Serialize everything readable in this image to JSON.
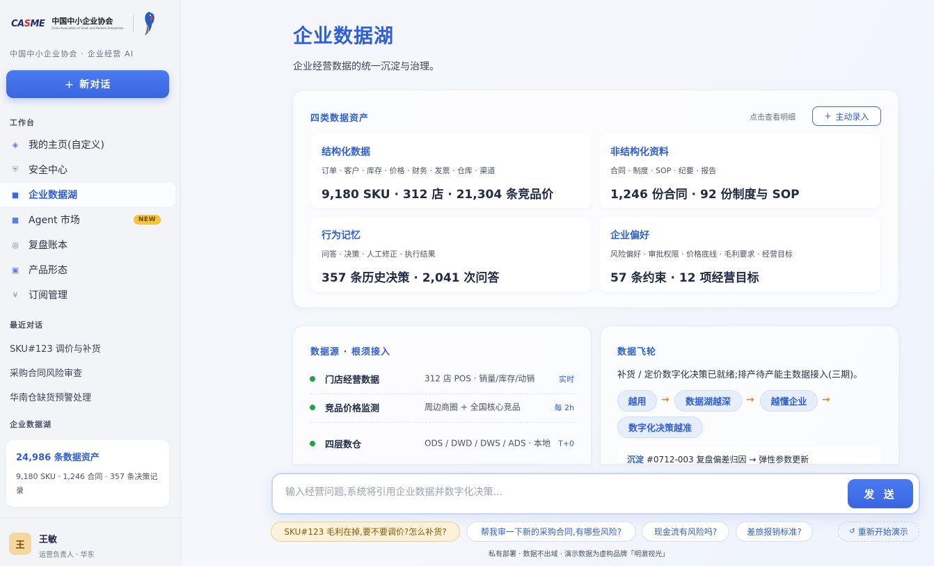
{
  "brand": {
    "org_mark": "CASME",
    "org_name": "中国中小企业协会",
    "org_name_en": "China Association of Small and Medium Enterprises",
    "caption": "中国中小企业协会 · 企业经营 AI"
  },
  "sidebar": {
    "new_chat_label": "新对话",
    "workspace_title": "工作台",
    "items": [
      {
        "label": "我的主页(自定义)"
      },
      {
        "label": "安全中心"
      },
      {
        "label": "企业数据湖"
      },
      {
        "label": "Agent 市场",
        "badge": "NEW"
      },
      {
        "label": "复盘账本"
      },
      {
        "label": "产品形态"
      },
      {
        "label": "订阅管理"
      }
    ],
    "recent_title": "最近对话",
    "recent": [
      {
        "label": "SKU#123 调价与补货"
      },
      {
        "label": "采购合同风险审查"
      },
      {
        "label": "华南仓缺货预警处理"
      }
    ],
    "lake_title": "企业数据湖",
    "lake_card": {
      "headline": "24,986 条数据资产",
      "detail": "9,180 SKU · 1,246 合同 · 357 条决策记录"
    },
    "user": {
      "avatar": "王",
      "name": "王敏",
      "role": "运营负责人 · 华东"
    }
  },
  "main": {
    "title": "企业数据湖",
    "subtitle": "企业经营数据的统一沉淀与治理。",
    "assets": {
      "title": "四类数据资产",
      "hint": "点击查看明细",
      "entry_button": "主动录入",
      "cards": [
        {
          "name": "结构化数据",
          "tags": "订单 · 客户 · 库存 · 价格 · 财务 · 发票 · 仓库 · 渠道",
          "stat": "9,180 SKU · 312 店 · 21,304 条竞品价"
        },
        {
          "name": "非结构化资料",
          "tags": "合同 · 制度 · SOP · 纪要 · 报告",
          "stat": "1,246 份合同 · 92 份制度与 SOP"
        },
        {
          "name": "行为记忆",
          "tags": "问答 · 决策 · 人工修正 · 执行结果",
          "stat": "357 条历史决策 · 2,041 次问答"
        },
        {
          "name": "企业偏好",
          "tags": "风险偏好 · 审批权限 · 价格底线 · 毛利要求 · 经营目标",
          "stat": "57 条约束 · 12 项经营目标"
        }
      ]
    },
    "sources": {
      "title": "数据源 · 根须接入",
      "rows": [
        {
          "name": "门店经营数据",
          "desc": "312 店 POS · 销量/库存/动销",
          "freq": "实时"
        },
        {
          "name": "竞品价格监测",
          "desc": "周边商圈 + 全国核心竞品",
          "freq": "每 2h"
        },
        {
          "name": "四层数仓",
          "desc": "ODS / DWD / DWS / ADS · 本地",
          "freq": "T+0"
        }
      ]
    },
    "flywheel": {
      "title": "数据飞轮",
      "text": "补货 / 定价数字化决策已就绪;排产待产能主数据接入(三期)。",
      "steps": [
        "越用",
        "数据湖越深",
        "越懂企业",
        "数字化决策越准"
      ],
      "deposit_key": "沉淀",
      "deposit_text": "#0712-003 复盘偏差归因 → 弹性参数更新"
    },
    "chat": {
      "placeholder": "输入经营问题,系统将引用企业数据并数字化决策...",
      "value": "",
      "send_label": "发 送",
      "quick": [
        "SKU#123 毛利在掉,要不要调价?怎么补货?",
        "帮我审一下新的采购合同,有哪些风险?",
        "现金流有风险吗?",
        "差旅报销标准?"
      ],
      "restart_label": "重新开始演示",
      "footer": "私有部署 · 数据不出域 · 演示数据为虚构品牌「明澈视光」"
    }
  },
  "colors": {
    "accent": "#2f5fd6",
    "button": "#3a66e0",
    "badge": "#f5c23b",
    "live_dot": "#1fa34a",
    "arrow": "#e08a1e"
  }
}
